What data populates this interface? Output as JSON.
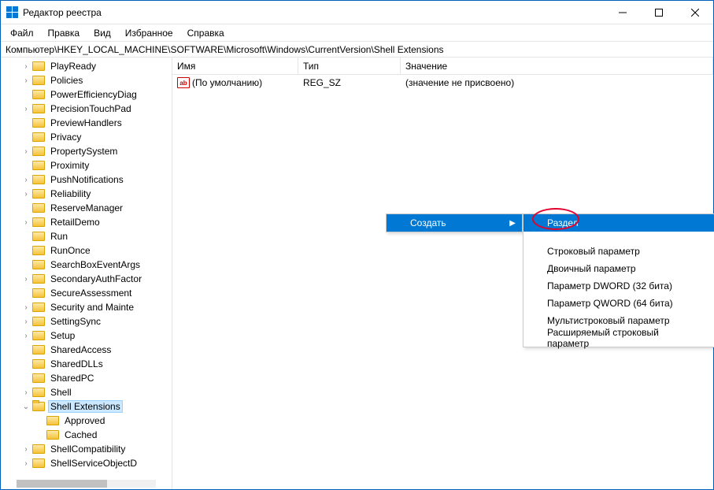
{
  "window": {
    "title": "Редактор реестра"
  },
  "menu": {
    "file": "Файл",
    "edit": "Правка",
    "view": "Вид",
    "favorites": "Избранное",
    "help": "Справка"
  },
  "path": "Компьютер\\HKEY_LOCAL_MACHINE\\SOFTWARE\\Microsoft\\Windows\\CurrentVersion\\Shell Extensions",
  "tree": [
    {
      "label": "PlayReady",
      "exp": ">"
    },
    {
      "label": "Policies",
      "exp": ">"
    },
    {
      "label": "PowerEfficiencyDiag",
      "exp": ""
    },
    {
      "label": "PrecisionTouchPad",
      "exp": ">"
    },
    {
      "label": "PreviewHandlers",
      "exp": ""
    },
    {
      "label": "Privacy",
      "exp": ""
    },
    {
      "label": "PropertySystem",
      "exp": ">"
    },
    {
      "label": "Proximity",
      "exp": ""
    },
    {
      "label": "PushNotifications",
      "exp": ">"
    },
    {
      "label": "Reliability",
      "exp": ">"
    },
    {
      "label": "ReserveManager",
      "exp": ""
    },
    {
      "label": "RetailDemo",
      "exp": ">"
    },
    {
      "label": "Run",
      "exp": ""
    },
    {
      "label": "RunOnce",
      "exp": ""
    },
    {
      "label": "SearchBoxEventArgs",
      "exp": ""
    },
    {
      "label": "SecondaryAuthFactor",
      "exp": ">"
    },
    {
      "label": "SecureAssessment",
      "exp": ""
    },
    {
      "label": "Security and Mainte",
      "exp": ">"
    },
    {
      "label": "SettingSync",
      "exp": ">"
    },
    {
      "label": "Setup",
      "exp": ">"
    },
    {
      "label": "SharedAccess",
      "exp": ""
    },
    {
      "label": "SharedDLLs",
      "exp": ""
    },
    {
      "label": "SharedPC",
      "exp": ""
    },
    {
      "label": "Shell",
      "exp": ">"
    },
    {
      "label": "Shell Extensions",
      "exp": "v",
      "selected": true
    },
    {
      "label": "Approved",
      "exp": "",
      "child": true
    },
    {
      "label": "Cached",
      "exp": "",
      "child": true
    },
    {
      "label": "ShellCompatibility",
      "exp": ">"
    },
    {
      "label": "ShellServiceObjectD",
      "exp": ">"
    }
  ],
  "values": {
    "header": {
      "name": "Имя",
      "type": "Тип",
      "data": "Значение"
    },
    "row": {
      "name": "(По умолчанию)",
      "type": "REG_SZ",
      "data": "(значение не присвоено)",
      "icon": "ab"
    }
  },
  "ctx": {
    "create": "Создать",
    "sub": [
      "Раздел",
      "Строковый параметр",
      "Двоичный параметр",
      "Параметр DWORD (32 бита)",
      "Параметр QWORD (64 бита)",
      "Мультистроковый параметр",
      "Расширяемый строковый параметр"
    ]
  }
}
